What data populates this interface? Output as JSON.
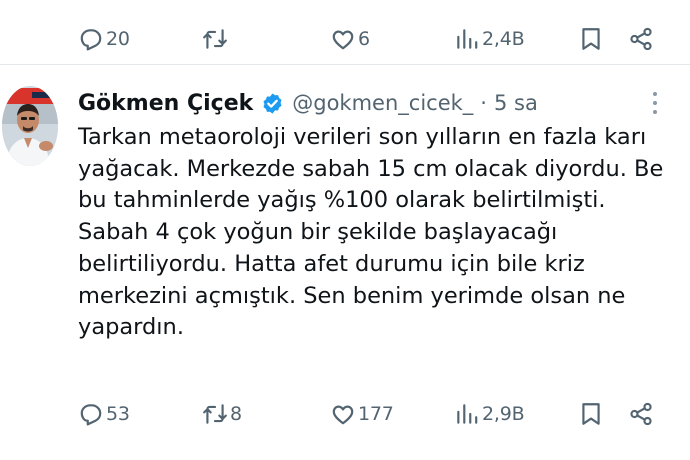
{
  "prev_tweet": {
    "reply_count": "20",
    "retweet_count": "",
    "like_count": "6",
    "view_count": "2,4B"
  },
  "tweet": {
    "author_name": "Gökmen Çiçek",
    "handle": "@gokmen_cicek_",
    "separator": "·",
    "time": "5 sa",
    "text": "Tarkan metaoroloji verileri son yılların en fazla karı yağacak. Merkezde sabah 15 cm olacak diyordu. Be bu tahminlerde yağış %100 olarak belirtilmişti. Sabah 4 çok yoğun bir şekilde başlayacağı belirtiliyordu. Hatta afet durumu için bile kriz merkezini açmıştık. Sen benim yerimde olsan ne yapardın.",
    "reply_count": "53",
    "retweet_count": "8",
    "like_count": "177",
    "view_count": "2,9B",
    "verified_badge_color": "#1d9bf0"
  },
  "icons": [
    "reply-icon",
    "retweet-icon",
    "like-icon",
    "views-icon",
    "bookmark-icon",
    "share-icon",
    "verified-badge-icon",
    "more-options-icon"
  ]
}
